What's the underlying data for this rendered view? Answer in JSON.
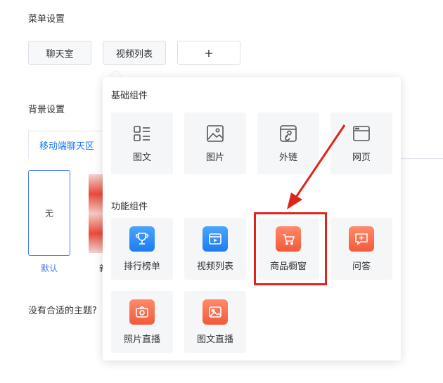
{
  "menu": {
    "title": "菜单设置",
    "buttons": [
      "聊天室",
      "视频列表",
      "+"
    ]
  },
  "background": {
    "title": "背景设置",
    "tab": "移动端聊天区",
    "theme_none": "无",
    "theme_default_label": "默认",
    "theme_partial_label": "新",
    "no_theme_text": "没有合适的主题?"
  },
  "popover": {
    "basic_title": "基础组件",
    "basic_items": [
      {
        "label": "图文",
        "icon": "image-text-icon"
      },
      {
        "label": "图片",
        "icon": "picture-icon"
      },
      {
        "label": "外链",
        "icon": "external-link-icon"
      },
      {
        "label": "网页",
        "icon": "webpage-icon"
      }
    ],
    "func_title": "功能组件",
    "func_items": [
      {
        "label": "排行榜单",
        "icon": "trophy-icon",
        "color": "#1d7cf2"
      },
      {
        "label": "视频列表",
        "icon": "video-list-icon",
        "color": "#1d7cf2"
      },
      {
        "label": "商品橱窗",
        "icon": "shopping-cart-icon",
        "color": "#f25a3a"
      },
      {
        "label": "问答",
        "icon": "qa-chat-icon",
        "color": "#f25a3a"
      },
      {
        "label": "照片直播",
        "icon": "camera-icon",
        "color": "#f25a3a"
      },
      {
        "label": "图文直播",
        "icon": "image-live-icon",
        "color": "#f25a3a"
      }
    ]
  },
  "annotation": {
    "color": "#e0241b"
  }
}
